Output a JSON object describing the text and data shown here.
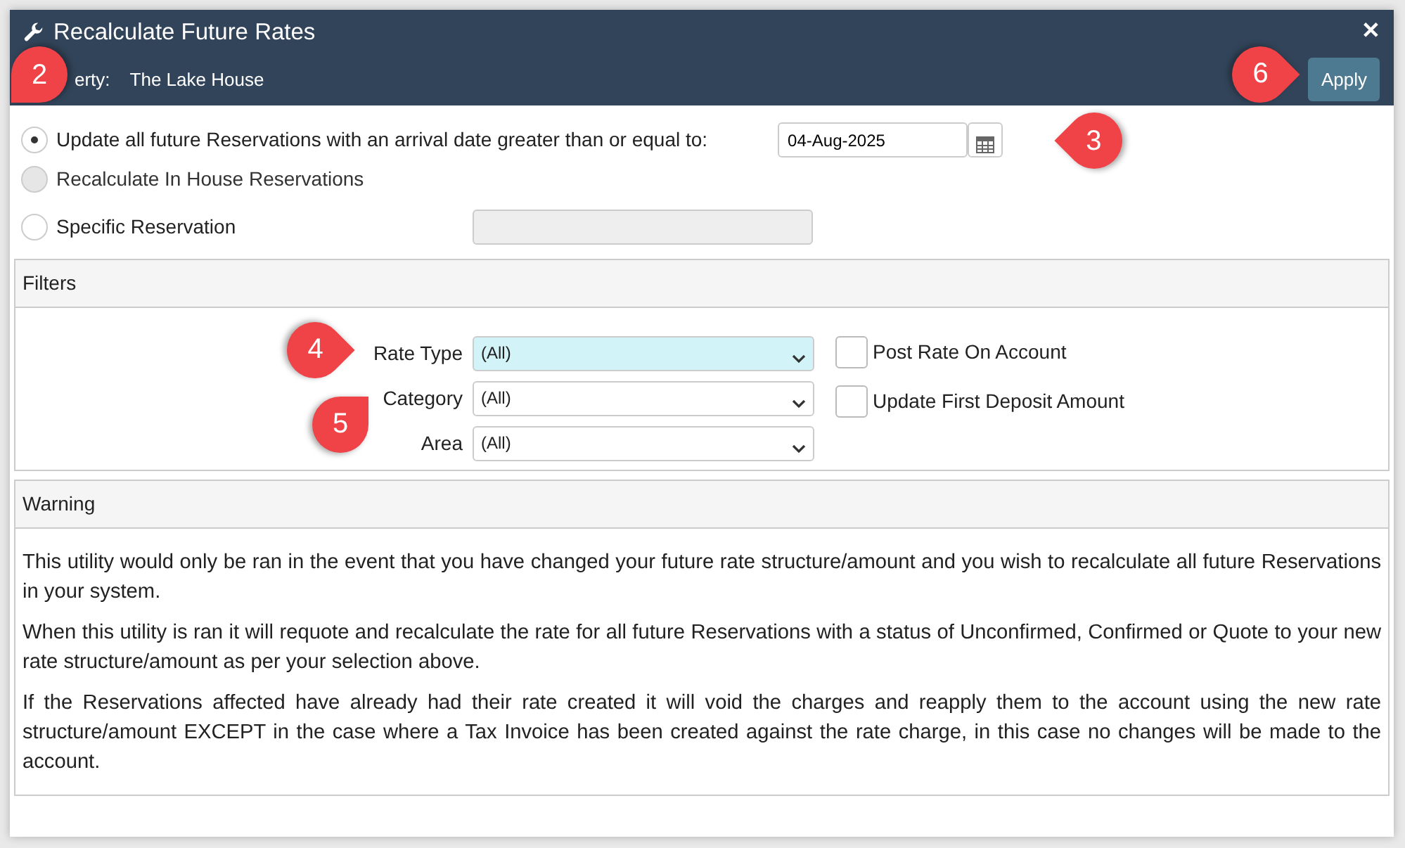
{
  "window": {
    "title": "Recalculate Future Rates",
    "close": "✕"
  },
  "property": {
    "label": "erty:",
    "value": "The Lake House"
  },
  "apply_button": "Apply",
  "options": [
    {
      "kind": "date",
      "label": "Update all future Reservations with an arrival date greater than or equal to:",
      "selected": true,
      "disabled": false,
      "value": "04-Aug-2025"
    },
    {
      "kind": "plain",
      "label": "Recalculate In House Reservations",
      "selected": false,
      "disabled": true
    },
    {
      "kind": "text",
      "label": "Specific Reservation",
      "selected": false,
      "disabled": false
    }
  ],
  "filters": {
    "title": "Filters",
    "selects": [
      {
        "label": "Rate Type",
        "value": "(All)",
        "focused": true
      },
      {
        "label": "Category",
        "value": "(All)",
        "focused": false
      },
      {
        "label": "Area",
        "value": "(All)",
        "focused": false
      }
    ],
    "checkboxes": [
      {
        "label": "Post Rate On Account",
        "checked": false
      },
      {
        "label": "Update First Deposit Amount",
        "checked": false
      }
    ]
  },
  "warning": {
    "title": "Warning",
    "paragraphs": [
      "This utility would only be ran in the event that you have changed your future rate structure/amount and you wish to recalculate all future Reservations in your system.",
      "When this utility is ran it will requote and recalculate the rate for all future Reservations with a status of Unconfirmed, Confirmed or Quote to your new rate structure/amount as per your selection above.",
      "If the Reservations affected have already had their rate created it will void the charges and reapply them to the account using the new rate structure/amount EXCEPT in the case where a Tax Invoice has been created against the rate charge, in this case no changes will be made to the account."
    ]
  },
  "callouts": [
    {
      "number": "2",
      "kind": "downleft"
    },
    {
      "number": "3",
      "kind": "left"
    },
    {
      "number": "4",
      "kind": "right"
    },
    {
      "number": "5",
      "kind": "upright"
    },
    {
      "number": "6",
      "kind": "right"
    }
  ]
}
